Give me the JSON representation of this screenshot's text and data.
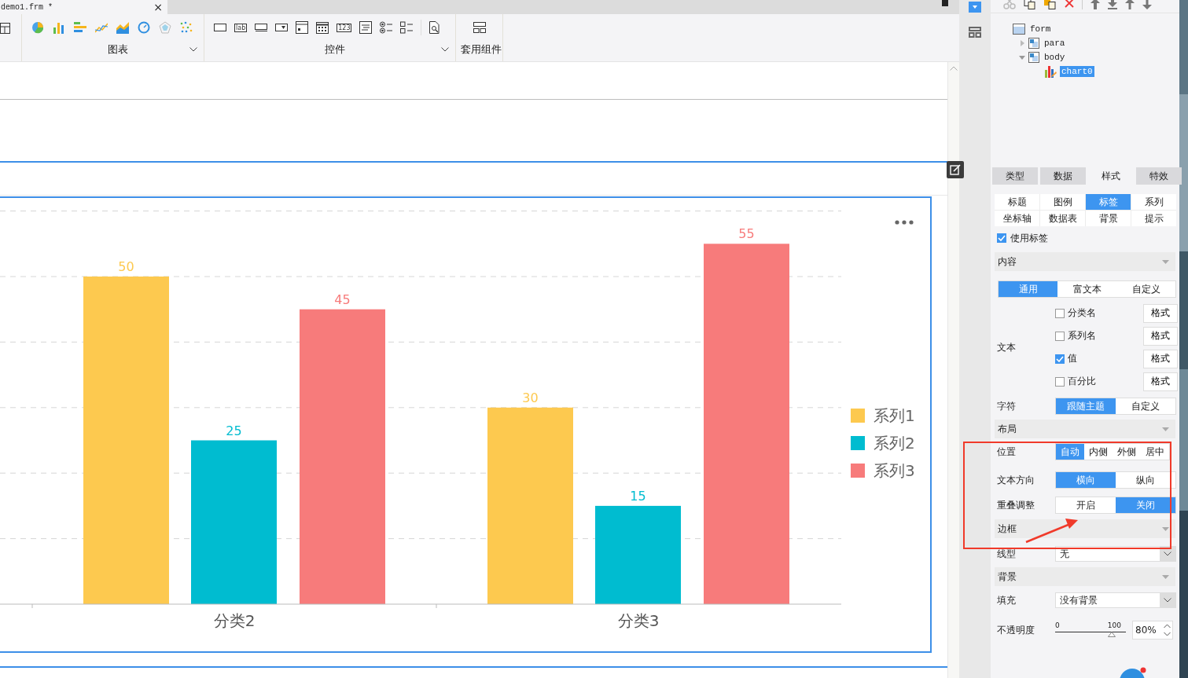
{
  "file_tab": {
    "title": "demo1.frm *",
    "close": "×"
  },
  "toolbar": {
    "groups": [
      {
        "label": "图表",
        "chevron": true
      },
      {
        "label": "控件",
        "chevron": true
      },
      {
        "label": "套用组件",
        "chevron": false
      }
    ],
    "glyph_texts": [
      "lab",
      "123"
    ]
  },
  "chart": {
    "chart_data": {
      "type": "bar",
      "categories": [
        "分类2",
        "分类3"
      ],
      "data_labels": true,
      "legend": "right",
      "series": [
        {
          "name": "系列1",
          "color": "#fdc94f",
          "values": [
            50,
            30
          ]
        },
        {
          "name": "系列2",
          "color": "#00bcd0",
          "values": [
            25,
            15
          ]
        },
        {
          "name": "系列3",
          "color": "#f77b7b",
          "values": [
            45,
            55
          ]
        }
      ]
    }
  },
  "tree": [
    {
      "label": "form",
      "kind": "form",
      "selected": false,
      "children": [
        {
          "label": "para",
          "kind": "container",
          "selected": false,
          "expanded": false
        },
        {
          "label": "body",
          "kind": "container",
          "selected": false,
          "expanded": true,
          "children": [
            {
              "label": "chart0",
              "kind": "chart",
              "selected": true
            }
          ]
        }
      ]
    }
  ],
  "main_tabs": [
    {
      "label": "类型",
      "selected": false
    },
    {
      "label": "数据",
      "selected": false
    },
    {
      "label": "样式",
      "selected": true
    },
    {
      "label": "特效",
      "selected": false
    }
  ],
  "sub_tabs": [
    {
      "label": "标题",
      "selected": false
    },
    {
      "label": "图例",
      "selected": false
    },
    {
      "label": "标签",
      "selected": true
    },
    {
      "label": "系列",
      "selected": false
    },
    {
      "label": "坐标轴",
      "selected": false
    },
    {
      "label": "数据表",
      "selected": false
    },
    {
      "label": "背景",
      "selected": false
    },
    {
      "label": "提示",
      "selected": false
    }
  ],
  "use_label": {
    "label": "使用标签",
    "checked": true
  },
  "rows": [
    {
      "kind": "section",
      "label": "内容"
    },
    {
      "kind": "segmented",
      "options": [
        {
          "label": "通用",
          "selected": true
        },
        {
          "label": "富文本",
          "selected": false
        },
        {
          "label": "自定义",
          "selected": false
        }
      ]
    },
    {
      "kind": "checklist",
      "label": "文本",
      "items": [
        {
          "label": "分类名",
          "checked": false,
          "button": "格式"
        },
        {
          "label": "系列名",
          "checked": false,
          "button": "格式"
        },
        {
          "label": "值",
          "checked": true,
          "button": "格式"
        },
        {
          "label": "百分比",
          "checked": false,
          "button": "格式"
        }
      ]
    },
    {
      "kind": "segmented",
      "label": "字符",
      "options": [
        {
          "label": "跟随主题",
          "selected": true
        },
        {
          "label": "自定义",
          "selected": false
        }
      ]
    },
    {
      "kind": "section",
      "label": "布局"
    },
    {
      "kind": "segmented",
      "label": "位置",
      "options": [
        {
          "label": "自动",
          "selected": true
        },
        {
          "label": "内侧",
          "selected": false
        },
        {
          "label": "外侧",
          "selected": false
        },
        {
          "label": "居中",
          "selected": false
        }
      ]
    },
    {
      "kind": "segmented",
      "label": "文本方向",
      "options": [
        {
          "label": "横向",
          "selected": true
        },
        {
          "label": "纵向",
          "selected": false
        }
      ]
    },
    {
      "kind": "segmented",
      "label": "重叠调整",
      "options": [
        {
          "label": "开启",
          "selected": false
        },
        {
          "label": "关闭",
          "selected": true
        }
      ]
    },
    {
      "kind": "section",
      "label": "边框"
    },
    {
      "kind": "select",
      "label": "线型",
      "value": "无"
    },
    {
      "kind": "section",
      "label": "背景"
    },
    {
      "kind": "select",
      "label": "填充",
      "value": "没有背景"
    },
    {
      "kind": "slider",
      "label": "不透明度",
      "min": "0",
      "max": "100",
      "level": 0.8,
      "value": "80%"
    }
  ]
}
